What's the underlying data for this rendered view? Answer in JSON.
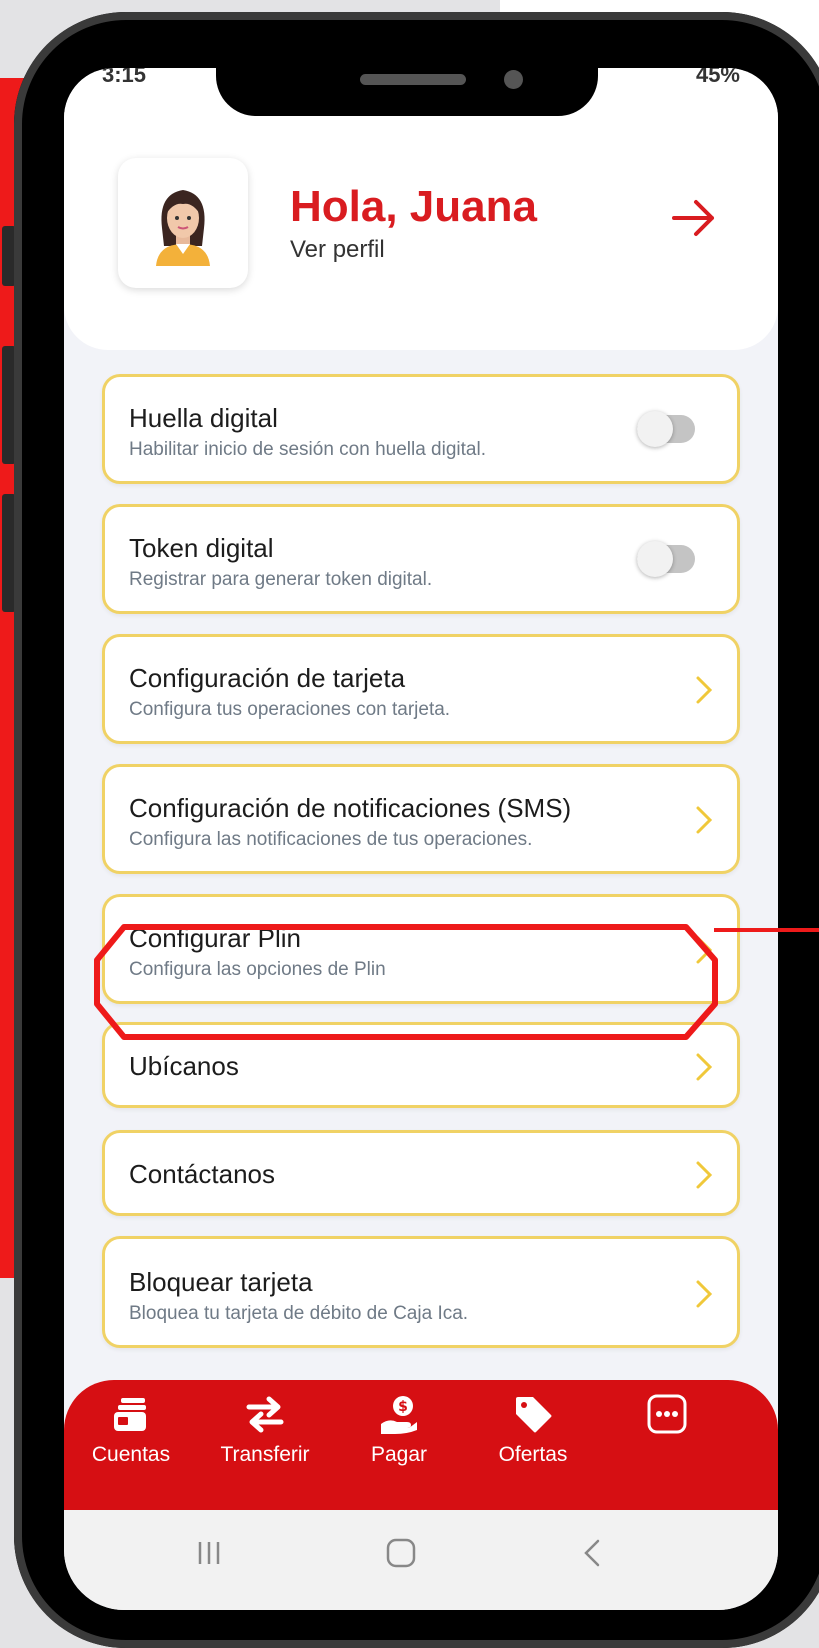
{
  "status_bar": {
    "time": "3:15",
    "battery": "45%"
  },
  "profile": {
    "greeting": "Hola, Juana",
    "link": "Ver perfil"
  },
  "settings": [
    {
      "title": "Huella digital",
      "subtitle": "Habilitar inicio de sesión con huella digital.",
      "control": "toggle",
      "enabled": false
    },
    {
      "title": "Token digital",
      "subtitle": "Registrar para generar token digital.",
      "control": "toggle",
      "enabled": false
    },
    {
      "title": "Configuración de tarjeta",
      "subtitle": "Configura tus operaciones con tarjeta.",
      "control": "chevron"
    },
    {
      "title": "Configuración de notificaciones (SMS)",
      "subtitle": "Configura las notificaciones de tus operaciones.",
      "control": "chevron"
    },
    {
      "title": "Configurar Plin",
      "subtitle": "Configura las opciones de Plin",
      "control": "chevron",
      "highlighted": true
    },
    {
      "title": "Ubícanos",
      "control": "chevron"
    },
    {
      "title": "Contáctanos",
      "control": "chevron"
    },
    {
      "title": "Bloquear tarjeta",
      "subtitle": "Bloquea tu tarjeta de débito de Caja Ica.",
      "control": "chevron"
    }
  ],
  "tabbar": [
    {
      "label": "Cuentas",
      "icon": "cards-icon"
    },
    {
      "label": "Transferir",
      "icon": "transfer-arrows-icon"
    },
    {
      "label": "Pagar",
      "icon": "pay-hand-coin-icon"
    },
    {
      "label": "Ofertas",
      "icon": "tag-icon"
    },
    {
      "label": "",
      "icon": "more-dots-icon"
    }
  ],
  "colors": {
    "brand_red": "#d91c20",
    "card_border": "#f0d265",
    "highlight": "#ee1a1a"
  }
}
